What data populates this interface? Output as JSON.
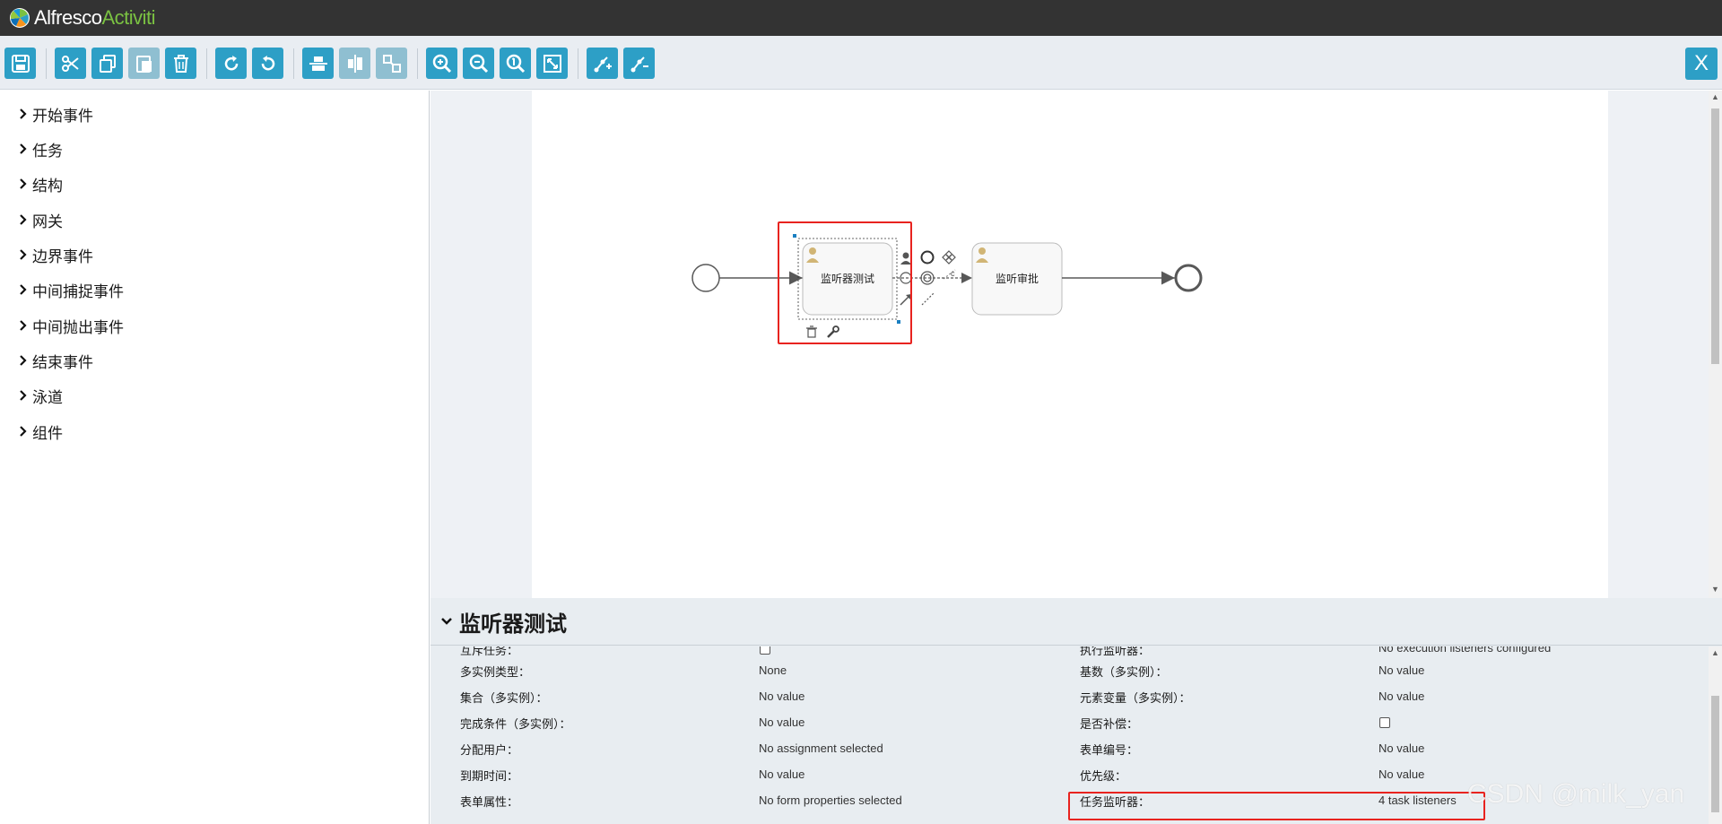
{
  "app": {
    "brand_primary": "Alfresco",
    "brand_secondary": "Activiti"
  },
  "toolbar": {
    "buttons": [
      {
        "name": "save-button",
        "icon": "save-icon"
      },
      {
        "name": "cut-button",
        "icon": "scissors-icon"
      },
      {
        "name": "copy-button",
        "icon": "copy-icon"
      },
      {
        "name": "paste-button",
        "icon": "paste-icon"
      },
      {
        "name": "delete-button",
        "icon": "trash-icon"
      },
      {
        "name": "redo-button",
        "icon": "redo-icon"
      },
      {
        "name": "undo-button",
        "icon": "undo-icon"
      },
      {
        "name": "align-horizontal-button",
        "icon": "align-horizontal-icon"
      },
      {
        "name": "align-vertical-button",
        "icon": "align-vertical-icon"
      },
      {
        "name": "same-size-button",
        "icon": "same-size-icon"
      },
      {
        "name": "zoom-in-button",
        "icon": "zoom-in-icon"
      },
      {
        "name": "zoom-out-button",
        "icon": "zoom-out-icon"
      },
      {
        "name": "zoom-actual-button",
        "icon": "zoom-actual-icon"
      },
      {
        "name": "zoom-fit-button",
        "icon": "zoom-fit-icon"
      },
      {
        "name": "add-bendpoint-button",
        "icon": "add-bendpoint-icon"
      },
      {
        "name": "remove-bendpoint-button",
        "icon": "remove-bendpoint-icon"
      }
    ],
    "close_label": "X"
  },
  "palette": {
    "items": [
      {
        "label": "开始事件"
      },
      {
        "label": "任务"
      },
      {
        "label": "结构"
      },
      {
        "label": "网关"
      },
      {
        "label": "边界事件"
      },
      {
        "label": "中间捕捉事件"
      },
      {
        "label": "中间抛出事件"
      },
      {
        "label": "结束事件"
      },
      {
        "label": "泳道"
      },
      {
        "label": "组件"
      }
    ]
  },
  "diagram": {
    "task1_label": "监听器测试",
    "task2_label": "监听审批",
    "selection_color": "#e8231f"
  },
  "properties": {
    "title": "监听器测试",
    "left": [
      {
        "label": "互斥任务：",
        "value": "",
        "type": "checkbox"
      },
      {
        "label": "多实例类型：",
        "value": "None"
      },
      {
        "label": "集合（多实例）：",
        "value": "No value"
      },
      {
        "label": "完成条件（多实例）：",
        "value": "No value"
      },
      {
        "label": "分配用户：",
        "value": "No assignment selected"
      },
      {
        "label": "到期时间：",
        "value": "No value"
      },
      {
        "label": "表单属性：",
        "value": "No form properties selected"
      }
    ],
    "right": [
      {
        "label": "执行监听器：",
        "value": "No execution listeners configured"
      },
      {
        "label": "基数（多实例）：",
        "value": "No value"
      },
      {
        "label": "元素变量（多实例）：",
        "value": "No value"
      },
      {
        "label": "是否补偿：",
        "value": "",
        "type": "checkbox"
      },
      {
        "label": "表单编号：",
        "value": "No value"
      },
      {
        "label": "优先级：",
        "value": "No value"
      },
      {
        "label": "任务监听器：",
        "value": "4 task listeners"
      }
    ]
  },
  "watermark": "CSDN @milk_yan",
  "colors": {
    "accent": "#2d9fc6",
    "header": "#333333",
    "highlight": "#e8231f"
  }
}
